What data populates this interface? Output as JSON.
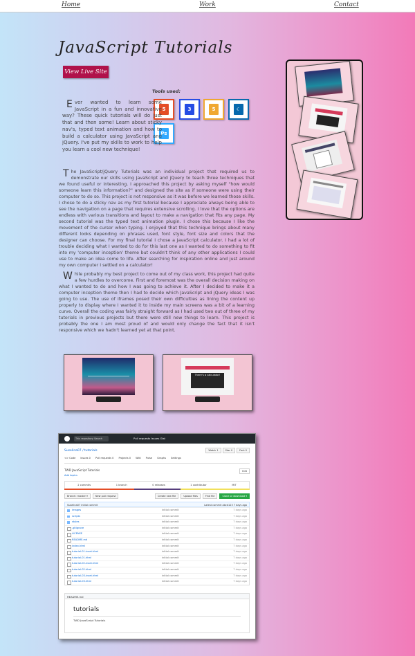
{
  "nav": {
    "home": "Home",
    "work": "Work",
    "contact": "Contact"
  },
  "page_title": "JavaScript Tutorials",
  "live_button": "View Live Site",
  "tools": {
    "label": "Tools used:",
    "items": [
      {
        "name": "html5-icon",
        "glyph": "5",
        "border": "#e44d26",
        "fill": "#e44d26"
      },
      {
        "name": "css3-icon",
        "glyph": "3",
        "border": "#264de4",
        "fill": "#264de4"
      },
      {
        "name": "javascript-icon",
        "glyph": "5",
        "border": "#f0a830",
        "fill": "#f0a830"
      },
      {
        "name": "jquery-icon",
        "glyph": "☾",
        "border": "#0769ad",
        "fill": "#0769ad"
      },
      {
        "name": "photoshop-icon",
        "glyph": "Ps",
        "border": "#31a8ff",
        "fill": "#31a8ff"
      }
    ]
  },
  "intro": {
    "drop": "E",
    "text": "ver wanted to learn some JavaScript in a fun and innovative way? These quick tutorials will do just that and then some! Learn about sticky nav's, typed text animation and how to build a calculator using JavaScript and jQuery. I've put my skills to work to help you learn a cool new technique!"
  },
  "paragraph2": {
    "drop": "T",
    "text": "he JavaScript/jQuery Tutorials was an individual project that required us to demonstrate our skills using JavaScript and jQuery to teach three techniques that we found useful or interesting. I approached this project by asking myself \"how would someone learn this information?\" and designed the site as if someone were using their computer to do so. This project is not responsive as it was before we learned those skills. I chose to do a sticky nav as my first tutorial because I appreciate always being able to see the navigation on a page that requires extensive scrolling. I love that the options are endless with various transitions and layout to make a navigation that fits any page. My second tutorial was the typed text animation plugin. I chose this because I like the movement of the cursor when typing. I enjoyed that this technique brings about many different looks depending on phrases used, font style, font size and colors that the designer can choose. For my final tutorial I chose a JavaScript calculator. I had a lot of trouble deciding what I wanted to do for this last one as I wanted to do something to fit into my 'computer inception' theme but couldn't think of any other applications I could use to make an idea come to life. After searching for inspiration online and just around my own computer I settled on a calculator!"
  },
  "paragraph3": {
    "drop": "W",
    "text": "hile probably my best project to come out of my class work, this project had quite a few hurdles to overcome. First and foremost was the overall decision making on what I wanted to do and how I was going to achieve it. After I decided to make it a computer inception theme then I had to decide which JavaScript and jQuery ideas I was going to use. The use of iframes posed their own difficulties as lining the content up properly to display where I wanted it to inside my main screens was a bit of a learning curve. Overall the coding was fairly straight forward as I had used two out of three of my tutorials in previous projects but there were still new things to learn. This project is probably the one I am most proud of and would only change the fact that it isn't responsive which we hadn't learned yet at that point."
  },
  "monitor2_text": "There's a calculator!",
  "github": {
    "search_placeholder": "This repository   Search",
    "top_links": "Pull requests   Issues   Gist",
    "repo": "Suselina07 / tutorials",
    "actions": [
      "Watch 1",
      "Star 0",
      "Fork 0"
    ],
    "tabs": [
      "<> Code",
      "Issues 0",
      "Pull requests 0",
      "Projects 0",
      "Wiki",
      "Pulse",
      "Graphs",
      "Settings"
    ],
    "description": "TWD JavaScript Tutorials",
    "topics": "Add topics",
    "edit": "Edit",
    "stats": [
      "2 commits",
      "1 branch",
      "0 releases",
      "1 contributor",
      "MIT"
    ],
    "branch": [
      "Branch: master ▾",
      "New pull request"
    ],
    "right_buttons": [
      "Create new file",
      "Upload files",
      "Find file",
      "Clone or download ▾"
    ],
    "commit_bar": "Suselina07 initial commit",
    "latest": "Latest commit abcd123 7 days ago",
    "files": [
      {
        "name": "images",
        "msg": "initial commit",
        "age": "7 days ago",
        "dir": true
      },
      {
        "name": "scripts",
        "msg": "initial commit",
        "age": "7 days ago",
        "dir": true
      },
      {
        "name": "styles",
        "msg": "initial commit",
        "age": "7 days ago",
        "dir": true
      },
      {
        "name": ".gitignore",
        "msg": "initial commit",
        "age": "7 days ago",
        "dir": false
      },
      {
        "name": "LICENSE",
        "msg": "initial commit",
        "age": "7 days ago",
        "dir": false
      },
      {
        "name": "README.md",
        "msg": "initial commit",
        "age": "7 days ago",
        "dir": false
      },
      {
        "name": "index.html",
        "msg": "initial commit",
        "age": "7 days ago",
        "dir": false
      },
      {
        "name": "tutorial-01-inset.html",
        "msg": "initial commit",
        "age": "7 days ago",
        "dir": false
      },
      {
        "name": "tutorial-01.html",
        "msg": "initial commit",
        "age": "7 days ago",
        "dir": false
      },
      {
        "name": "tutorial-02-inset.html",
        "msg": "initial commit",
        "age": "7 days ago",
        "dir": false
      },
      {
        "name": "tutorial-02.html",
        "msg": "initial commit",
        "age": "7 days ago",
        "dir": false
      },
      {
        "name": "tutorial-03-inset.html",
        "msg": "initial commit",
        "age": "7 days ago",
        "dir": false
      },
      {
        "name": "tutorial-03.html",
        "msg": "initial commit",
        "age": "7 days ago",
        "dir": false
      }
    ],
    "readme_bar": "README.md",
    "readme_title": "tutorials",
    "readme_text": "TWD JavaScript Tutorials"
  }
}
